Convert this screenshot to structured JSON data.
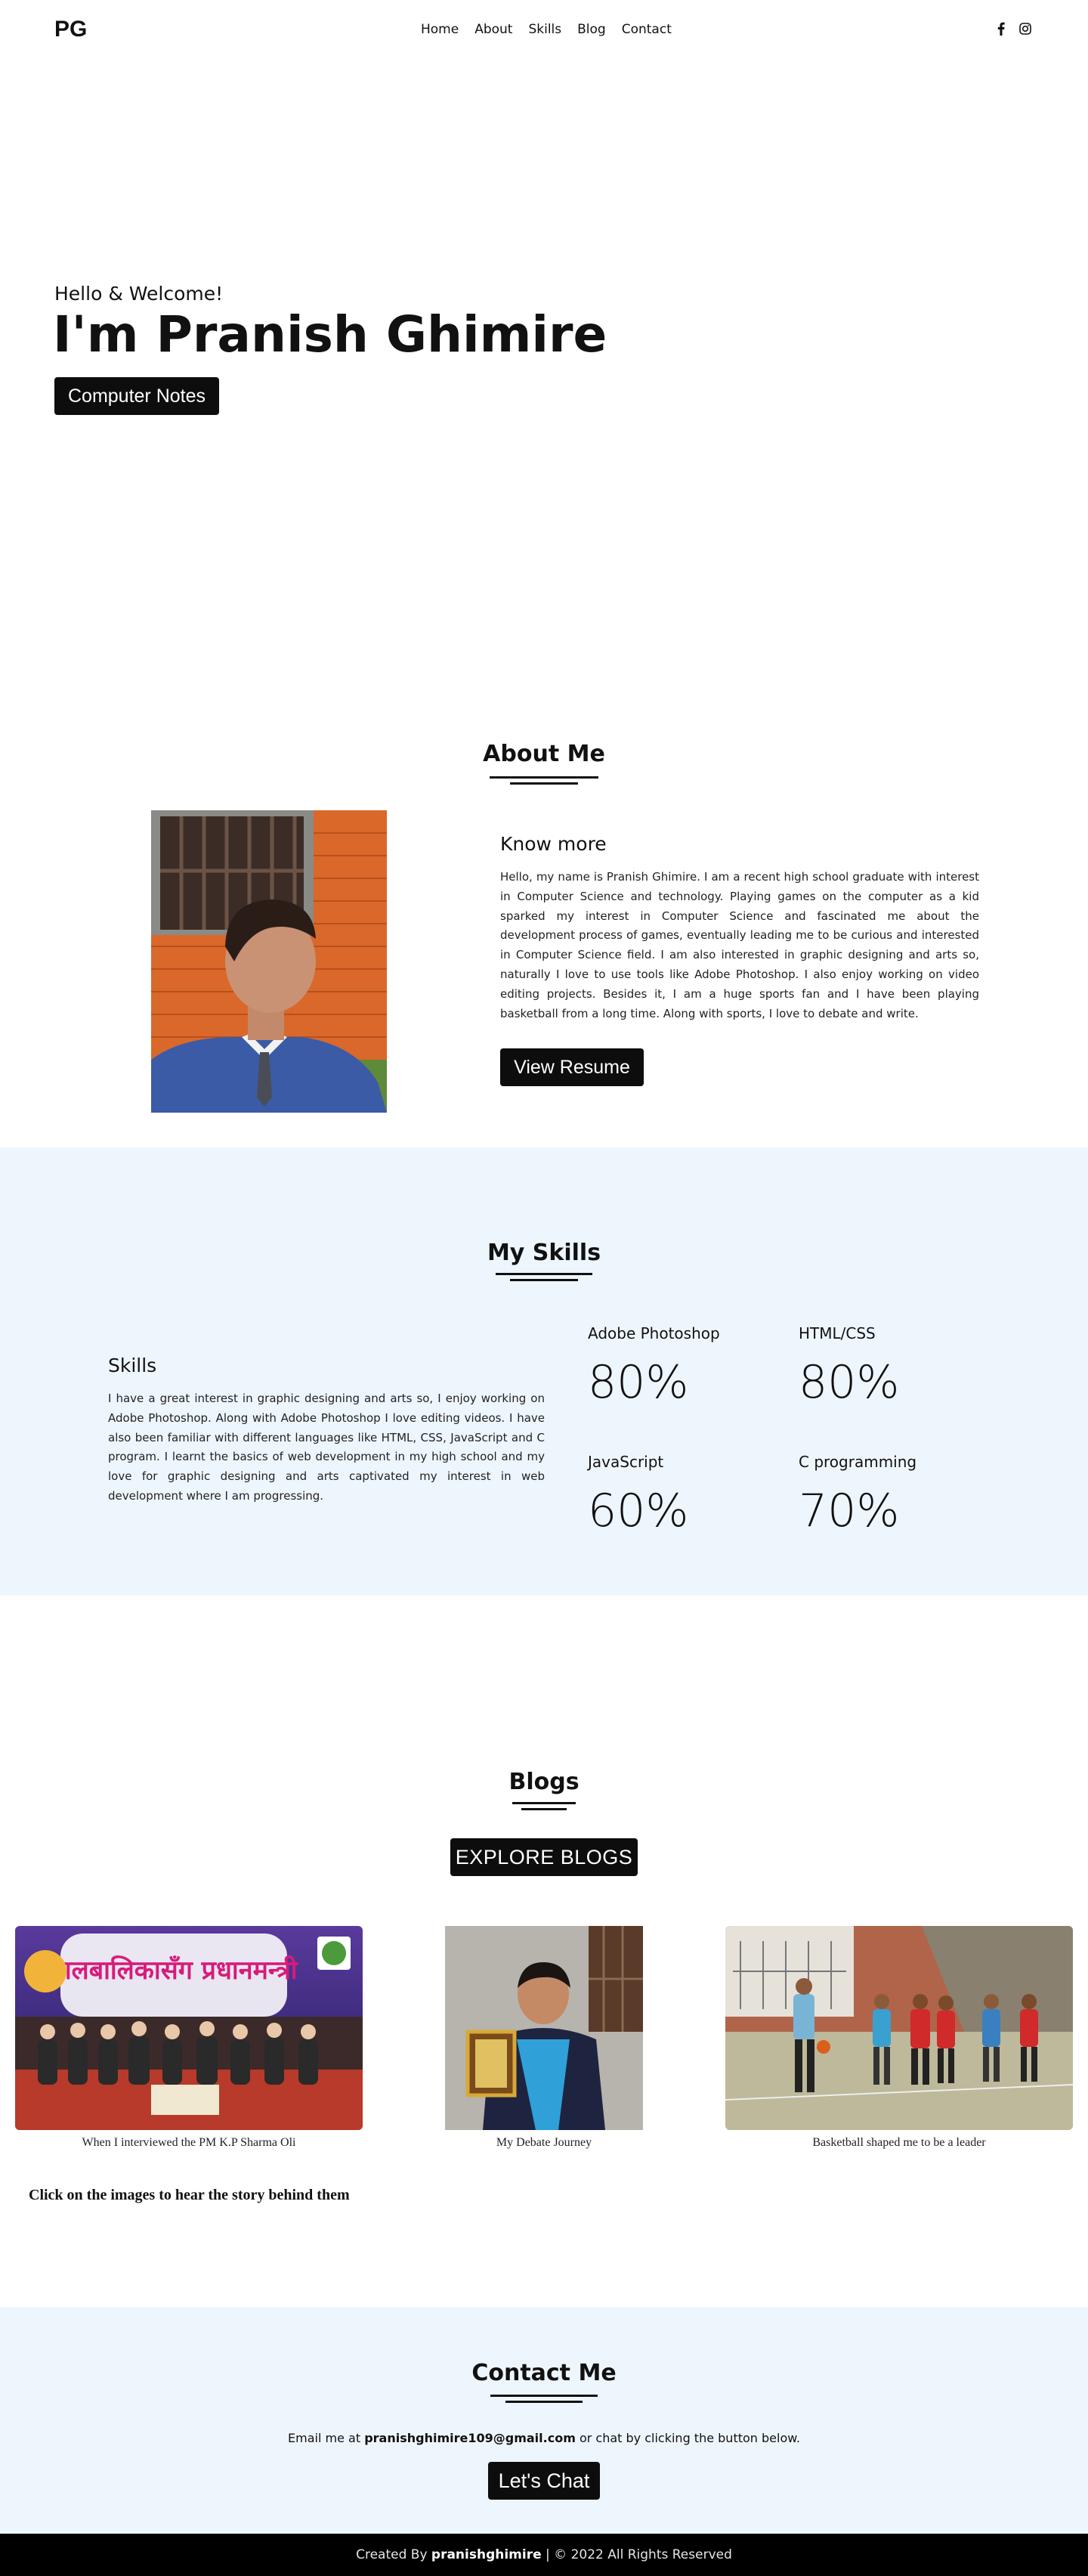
{
  "nav": {
    "logo": "PG",
    "items": [
      "Home",
      "About",
      "Skills",
      "Blog",
      "Contact"
    ],
    "social": [
      "facebook-icon",
      "instagram-icon"
    ]
  },
  "hero": {
    "greeting": "Hello & Welcome!",
    "name": "I'm Pranish Ghimire",
    "button": "Computer Notes"
  },
  "about": {
    "title": "About Me",
    "subtitle": "Know more",
    "text": "Hello, my name is Pranish Ghimire. I am a recent high school graduate with interest in Computer Science and technology. Playing games on the computer as a kid sparked my interest in Computer Science and fascinated me about the development process of games, eventually leading me to be curious and interested in Computer Science field. I am also interested in graphic designing and arts so, naturally I love to use tools like Adobe Photoshop. I also enjoy working on video editing projects. Besides it, I am a huge sports fan and I have been playing basketball from a long time. Along with sports, I love to debate and write.",
    "button": "View Resume"
  },
  "skills": {
    "title": "My Skills",
    "subtitle": "Skills",
    "text": "I have a great interest in graphic designing and arts so, I enjoy working on Adobe Photoshop. Along with Adobe Photoshop I love editing videos. I have also been familiar with different languages like HTML, CSS, JavaScript and C program. I learnt the basics of web development in my high school and my love for graphic designing and arts captivated my interest in web development where I am progressing.",
    "items": [
      {
        "name": "Adobe Photoshop",
        "percent": "80%"
      },
      {
        "name": "HTML/CSS",
        "percent": "80%"
      },
      {
        "name": "JavaScript",
        "percent": "60%"
      },
      {
        "name": "C programming",
        "percent": "70%"
      }
    ]
  },
  "blogs": {
    "title": "Blogs",
    "button": "EXPLORE BLOGS",
    "items": [
      {
        "caption": "When I interviewed the PM K.P Sharma Oli",
        "banner": "बालबालिकासँग प्रधानमन्त्री"
      },
      {
        "caption": "My Debate Journey"
      },
      {
        "caption": "Basketball shaped me to be a leader"
      }
    ],
    "note": "Click on the images to hear the story behind them"
  },
  "contact": {
    "title": "Contact Me",
    "prefix": "Email me at ",
    "email": "pranishghimire109@gmail.com",
    "suffix": " or chat by clicking the button below.",
    "button": "Let's Chat"
  },
  "footer": {
    "prefix": "Created By ",
    "author": "pranishghimire",
    "suffix": " | © 2022 All Rights Reserved"
  }
}
